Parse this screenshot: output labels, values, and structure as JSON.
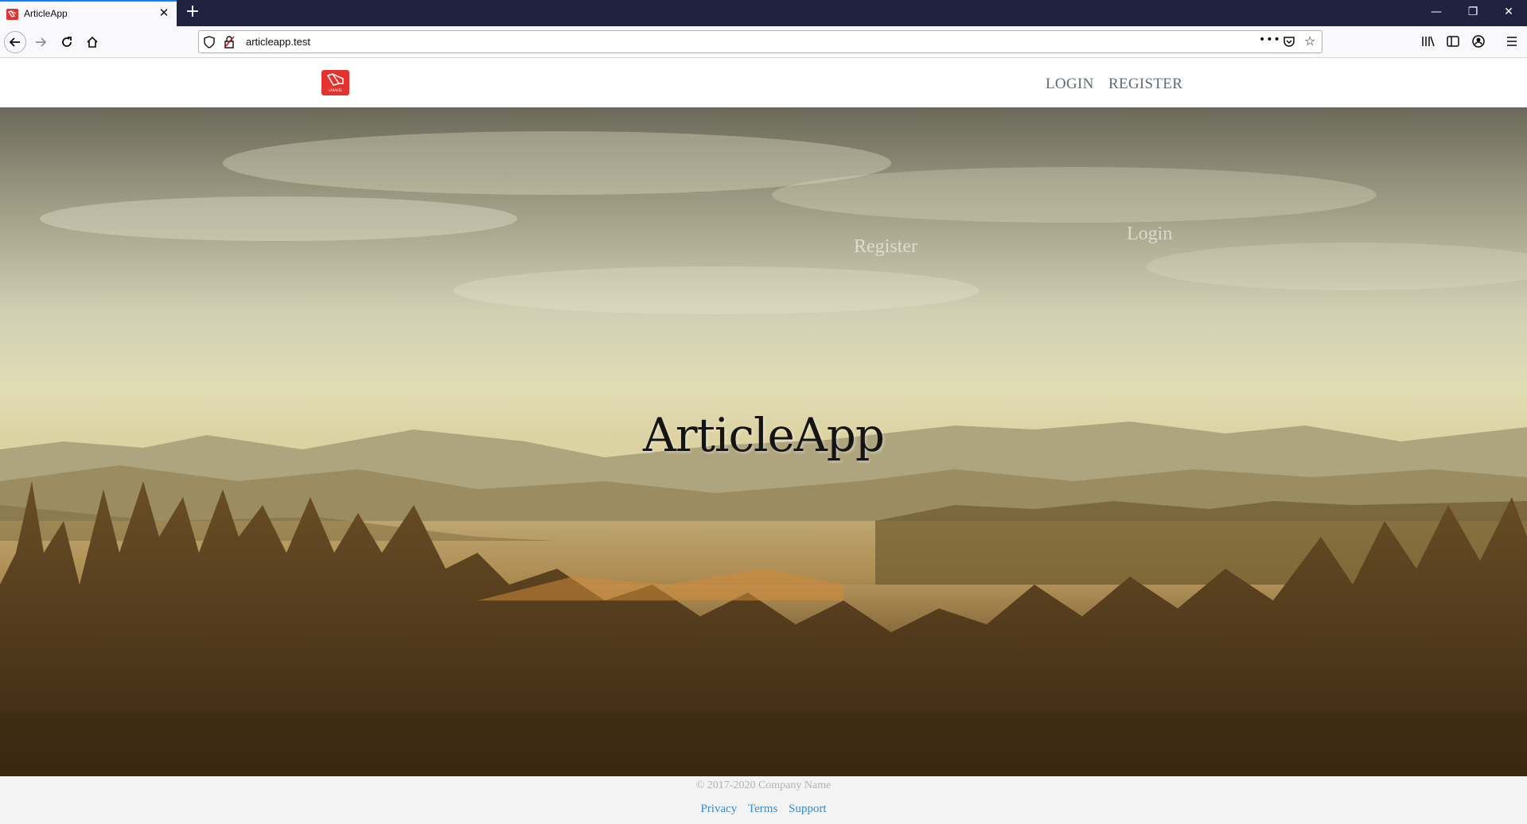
{
  "browser": {
    "tab_title": "ArticleApp",
    "tab_close": "✕",
    "new_tab": "+",
    "url": "articleapp.test",
    "window_controls": {
      "minimize": "—",
      "maximize": "❐",
      "close": "✕"
    },
    "icons": [
      "back-icon",
      "forward-icon",
      "reload-icon",
      "home-icon",
      "shield-icon",
      "insecure-lock-icon",
      "page-actions-icon",
      "pocket-icon",
      "bookmark-star-icon",
      "library-icon",
      "sidebar-icon",
      "account-icon",
      "menu-icon"
    ]
  },
  "header": {
    "logo_text": "LARAVEL",
    "nav": {
      "login": "LOGIN",
      "register": "REGISTER"
    }
  },
  "hero": {
    "links": {
      "register": "Register",
      "login": "Login"
    },
    "title": "ArticleApp"
  },
  "footer": {
    "copyright": "© 2017-2020 Company Name",
    "links": {
      "privacy": "Privacy",
      "terms": "Terms",
      "support": "Support"
    }
  },
  "colors": {
    "tabbar_bg": "#202340",
    "logo_red": "#e5322f",
    "nav_link": "#636b6f",
    "footer_link": "#3a8ac8",
    "footer_bg": "#f3f3f3"
  }
}
